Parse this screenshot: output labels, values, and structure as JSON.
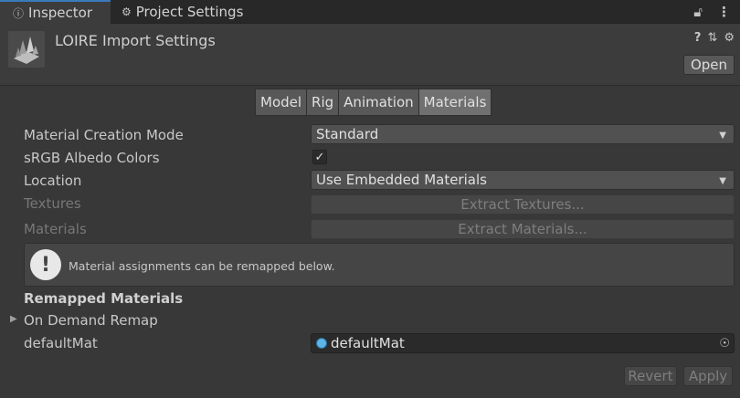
{
  "tabs": [
    {
      "label": "Inspector",
      "icon": "info-icon"
    },
    {
      "label": "Project Settings",
      "icon": "gear-icon"
    }
  ],
  "header": {
    "title": "LOIRE Import Settings",
    "open_label": "Open"
  },
  "segments": [
    "Model",
    "Rig",
    "Animation",
    "Materials"
  ],
  "selected_segment": "Materials",
  "fields": {
    "material_creation_mode": {
      "label": "Material Creation Mode",
      "value": "Standard"
    },
    "srgb_albedo": {
      "label": "sRGB Albedo Colors",
      "checked": true
    },
    "location": {
      "label": "Location",
      "value": "Use Embedded Materials"
    },
    "textures": {
      "label": "Textures",
      "button": "Extract Textures..."
    },
    "materials": {
      "label": "Materials",
      "button": "Extract Materials..."
    }
  },
  "help": {
    "text": "Material assignments can be remapped below."
  },
  "remapped": {
    "title": "Remapped Materials",
    "foldout": "On Demand Remap",
    "entry_label": "defaultMat",
    "entry_value": "defaultMat"
  },
  "footer": {
    "revert": "Revert",
    "apply": "Apply"
  },
  "colors": {
    "background": "#383838",
    "accent": "#3a79bb",
    "selected_segment": "#707070"
  }
}
